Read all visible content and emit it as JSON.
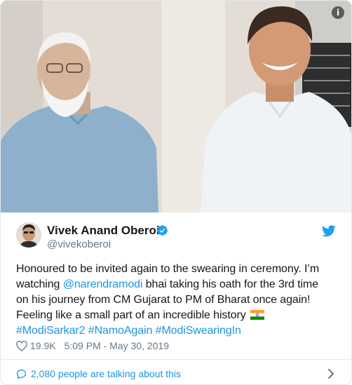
{
  "photo": {
    "info_glyph": "i"
  },
  "author": {
    "name": "Vivek Anand Oberoi",
    "handle": "@vivekoberoi",
    "verified_icon": "verified-badge-icon",
    "platform_icon": "twitter-bird-icon"
  },
  "tweet": {
    "line1": "Honoured to be invited again to the swearing in ceremony. I’m",
    "line2_prefix": "watching ",
    "mention": "@narendramodi",
    "line2_suffix": " bhai taking his oath for the 3rd time",
    "line3": "on his journey from CM Gujarat to PM of Bharat once again!",
    "line4": "Feeling like a small part of an incredible history",
    "hashtags": [
      "#ModiSarkar2",
      "#NamoAgain",
      "#ModiSwearingIn"
    ],
    "flag_icon": "india-flag-icon"
  },
  "meta": {
    "likes": "19.9K",
    "timestamp": "5:09 PM - May 30, 2019"
  },
  "footer": {
    "talking_label": "2,080 people are talking about this"
  },
  "colors": {
    "link": "#1b95e0",
    "text": "#14171a",
    "secondary": "#657786",
    "border": "#e1e8ed"
  }
}
